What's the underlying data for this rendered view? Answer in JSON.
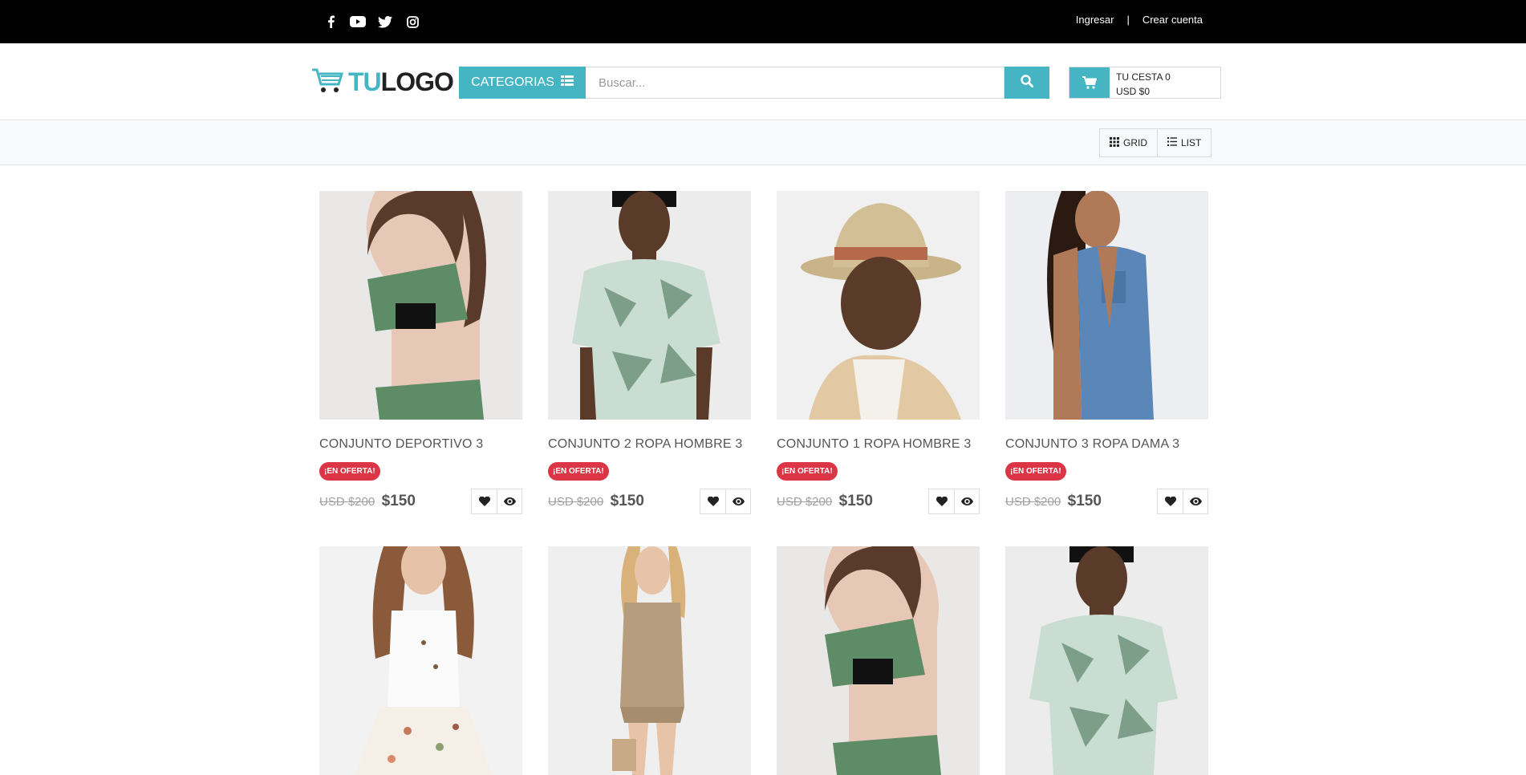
{
  "topbar": {
    "social": [
      "facebook-icon",
      "youtube-icon",
      "twitter-icon",
      "instagram-icon"
    ],
    "login_label": "Ingresar",
    "separator": "|",
    "register_label": "Crear cuenta"
  },
  "header": {
    "logo_part1": "TU",
    "logo_part2": "LOGO",
    "categories_label": "CATEGORIAS",
    "search_placeholder": "Buscar...",
    "cart_line1": "TU CESTA 0",
    "cart_line2": "USD $0"
  },
  "view": {
    "grid_label": "GRID",
    "list_label": "LIST"
  },
  "colors": {
    "accent": "#45b5c4",
    "badge": "#dc3545",
    "topbar": "#000000"
  },
  "products": [
    {
      "title": "CONJUNTO DEPORTIVO 3",
      "badge": "¡EN OFERTA!",
      "old_price": "USD $200",
      "price": "$150"
    },
    {
      "title": "CONJUNTO 2 ROPA HOMBRE 3",
      "badge": "¡EN OFERTA!",
      "old_price": "USD $200",
      "price": "$150"
    },
    {
      "title": "CONJUNTO 1 ROPA HOMBRE 3",
      "badge": "¡EN OFERTA!",
      "old_price": "USD $200",
      "price": "$150"
    },
    {
      "title": "CONJUNTO 3 ROPA DAMA 3",
      "badge": "¡EN OFERTA!",
      "old_price": "USD $200",
      "price": "$150"
    }
  ]
}
